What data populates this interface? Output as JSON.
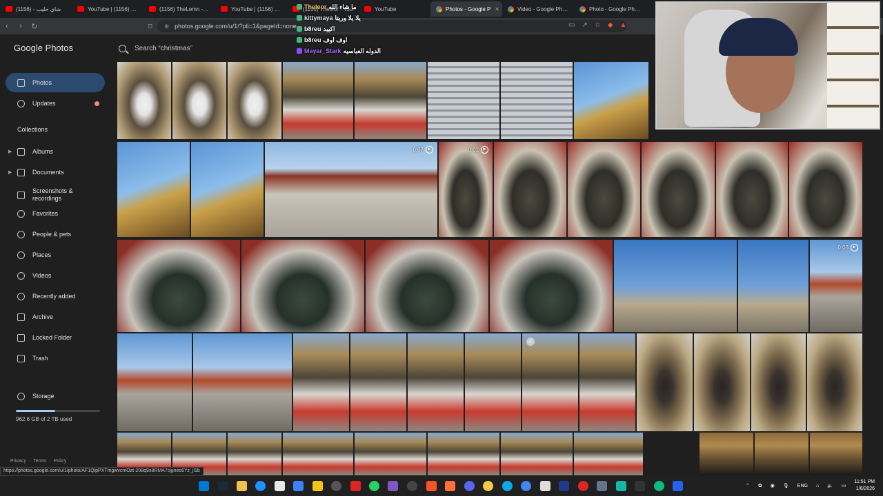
{
  "browser": {
    "tabs": [
      {
        "label": "شاي حليب - (1156)",
        "favicon": "youtube-icon",
        "active": false
      },
      {
        "label": "YouTube | (1156) زين",
        "favicon": "youtube-icon",
        "active": false
      },
      {
        "label": "(1156) TheLemn - You",
        "favicon": "youtube-icon",
        "active": false
      },
      {
        "label": "YouTube | (1156) راسي",
        "favicon": "youtube-icon",
        "active": false
      },
      {
        "label": "(1156) Theleor - You",
        "favicon": "youtube-icon",
        "active": false
      },
      {
        "label": "YouTube",
        "favicon": "youtube-icon",
        "active": false
      },
      {
        "label": "Photos - Google P",
        "favicon": "google-photos-icon",
        "active": true
      },
      {
        "label": "Video - Google Photo",
        "favicon": "google-photos-icon",
        "active": false
      },
      {
        "label": "Photo - Google Photo",
        "favicon": "google-photos-icon",
        "active": false
      }
    ],
    "url": "photos.google.com/u/1/?pli=1&pageId=none"
  },
  "app": {
    "logo": "Google Photos",
    "search_placeholder": "Search “christmas”"
  },
  "sidebar": {
    "items": [
      {
        "label": "Photos",
        "icon": "photo-icon",
        "active": true
      },
      {
        "label": "Updates",
        "icon": "bell-icon",
        "notification_dot": true
      }
    ],
    "collections_label": "Collections",
    "collections": [
      {
        "label": "Albums",
        "icon": "album-icon",
        "expandable": true
      },
      {
        "label": "Documents",
        "icon": "document-icon",
        "expandable": true
      },
      {
        "label": "Screenshots & recordings",
        "icon": "screenshot-icon"
      },
      {
        "label": "Favorites",
        "icon": "star-icon"
      },
      {
        "label": "People & pets",
        "icon": "people-icon"
      },
      {
        "label": "Places",
        "icon": "place-icon"
      },
      {
        "label": "Videos",
        "icon": "video-icon"
      },
      {
        "label": "Recently added",
        "icon": "recent-icon"
      },
      {
        "label": "Archive",
        "icon": "archive-icon"
      },
      {
        "label": "Locked Folder",
        "icon": "lock-icon"
      },
      {
        "label": "Trash",
        "icon": "trash-icon"
      }
    ],
    "storage": {
      "label": "Storage",
      "usage_text": "962.6 GB of 2 TB used",
      "fraction_used": 0.47
    },
    "footer": [
      "Privacy",
      "·",
      "Terms",
      "·",
      "Policy"
    ]
  },
  "grid": {
    "video_durations": [
      "0:07",
      "0:01",
      "0:06"
    ]
  },
  "chat": [
    {
      "user": "Theleor",
      "message": "ما شاء الله"
    },
    {
      "user": "kittymaya",
      "message": "يلا يلا وريتا"
    },
    {
      "user": "b8reu",
      "message": "اكييد"
    },
    {
      "user": "b8reu",
      "message": "اوف اوف"
    },
    {
      "user": "Mayar_Stark",
      "message": "الدوله العباسيه"
    }
  ],
  "status_url": "https://photos.google.com/u/1/photo/AF1QipPXTmgwvcmOzt-208q9x8RMA7cjgnes6Yz_jl1b",
  "taskbar": {
    "lang": "ENG",
    "time": "11:51 PM",
    "date": "1/6/2026"
  }
}
